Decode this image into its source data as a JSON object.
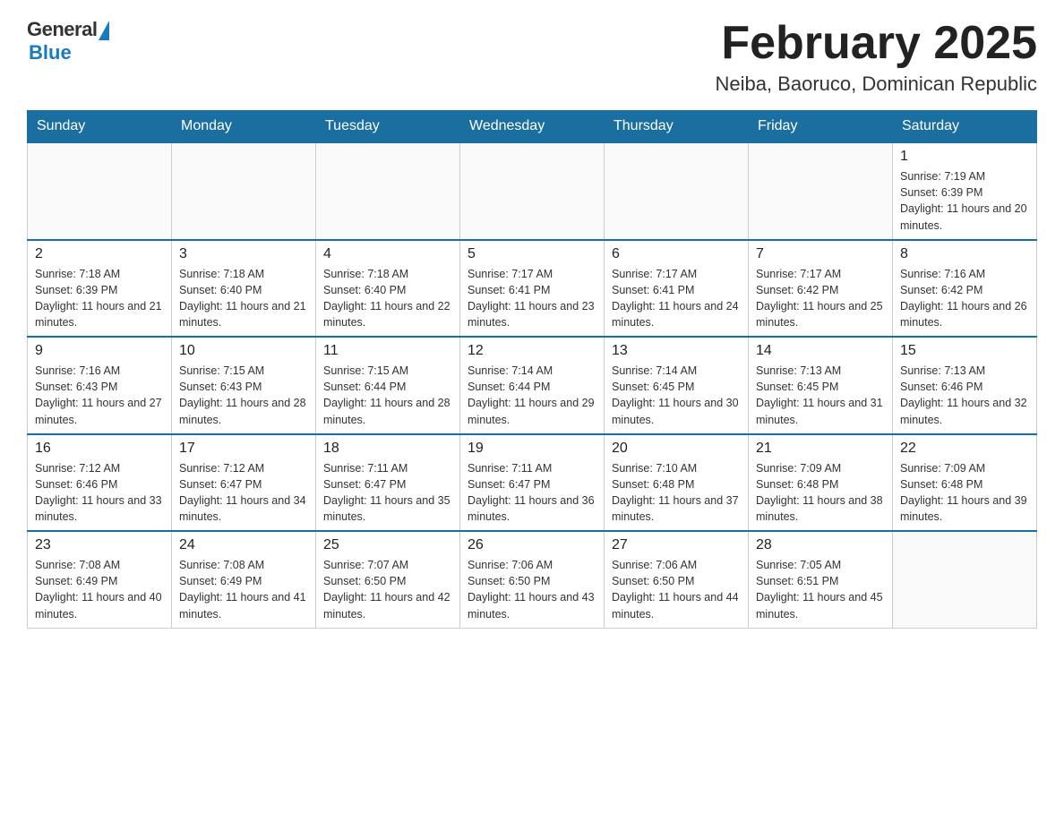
{
  "logo": {
    "general_text": "General",
    "blue_text": "Blue"
  },
  "header": {
    "month_year": "February 2025",
    "location": "Neiba, Baoruco, Dominican Republic"
  },
  "weekdays": [
    "Sunday",
    "Monday",
    "Tuesday",
    "Wednesday",
    "Thursday",
    "Friday",
    "Saturday"
  ],
  "weeks": [
    [
      {
        "day": "",
        "info": ""
      },
      {
        "day": "",
        "info": ""
      },
      {
        "day": "",
        "info": ""
      },
      {
        "day": "",
        "info": ""
      },
      {
        "day": "",
        "info": ""
      },
      {
        "day": "",
        "info": ""
      },
      {
        "day": "1",
        "info": "Sunrise: 7:19 AM\nSunset: 6:39 PM\nDaylight: 11 hours and 20 minutes."
      }
    ],
    [
      {
        "day": "2",
        "info": "Sunrise: 7:18 AM\nSunset: 6:39 PM\nDaylight: 11 hours and 21 minutes."
      },
      {
        "day": "3",
        "info": "Sunrise: 7:18 AM\nSunset: 6:40 PM\nDaylight: 11 hours and 21 minutes."
      },
      {
        "day": "4",
        "info": "Sunrise: 7:18 AM\nSunset: 6:40 PM\nDaylight: 11 hours and 22 minutes."
      },
      {
        "day": "5",
        "info": "Sunrise: 7:17 AM\nSunset: 6:41 PM\nDaylight: 11 hours and 23 minutes."
      },
      {
        "day": "6",
        "info": "Sunrise: 7:17 AM\nSunset: 6:41 PM\nDaylight: 11 hours and 24 minutes."
      },
      {
        "day": "7",
        "info": "Sunrise: 7:17 AM\nSunset: 6:42 PM\nDaylight: 11 hours and 25 minutes."
      },
      {
        "day": "8",
        "info": "Sunrise: 7:16 AM\nSunset: 6:42 PM\nDaylight: 11 hours and 26 minutes."
      }
    ],
    [
      {
        "day": "9",
        "info": "Sunrise: 7:16 AM\nSunset: 6:43 PM\nDaylight: 11 hours and 27 minutes."
      },
      {
        "day": "10",
        "info": "Sunrise: 7:15 AM\nSunset: 6:43 PM\nDaylight: 11 hours and 28 minutes."
      },
      {
        "day": "11",
        "info": "Sunrise: 7:15 AM\nSunset: 6:44 PM\nDaylight: 11 hours and 28 minutes."
      },
      {
        "day": "12",
        "info": "Sunrise: 7:14 AM\nSunset: 6:44 PM\nDaylight: 11 hours and 29 minutes."
      },
      {
        "day": "13",
        "info": "Sunrise: 7:14 AM\nSunset: 6:45 PM\nDaylight: 11 hours and 30 minutes."
      },
      {
        "day": "14",
        "info": "Sunrise: 7:13 AM\nSunset: 6:45 PM\nDaylight: 11 hours and 31 minutes."
      },
      {
        "day": "15",
        "info": "Sunrise: 7:13 AM\nSunset: 6:46 PM\nDaylight: 11 hours and 32 minutes."
      }
    ],
    [
      {
        "day": "16",
        "info": "Sunrise: 7:12 AM\nSunset: 6:46 PM\nDaylight: 11 hours and 33 minutes."
      },
      {
        "day": "17",
        "info": "Sunrise: 7:12 AM\nSunset: 6:47 PM\nDaylight: 11 hours and 34 minutes."
      },
      {
        "day": "18",
        "info": "Sunrise: 7:11 AM\nSunset: 6:47 PM\nDaylight: 11 hours and 35 minutes."
      },
      {
        "day": "19",
        "info": "Sunrise: 7:11 AM\nSunset: 6:47 PM\nDaylight: 11 hours and 36 minutes."
      },
      {
        "day": "20",
        "info": "Sunrise: 7:10 AM\nSunset: 6:48 PM\nDaylight: 11 hours and 37 minutes."
      },
      {
        "day": "21",
        "info": "Sunrise: 7:09 AM\nSunset: 6:48 PM\nDaylight: 11 hours and 38 minutes."
      },
      {
        "day": "22",
        "info": "Sunrise: 7:09 AM\nSunset: 6:48 PM\nDaylight: 11 hours and 39 minutes."
      }
    ],
    [
      {
        "day": "23",
        "info": "Sunrise: 7:08 AM\nSunset: 6:49 PM\nDaylight: 11 hours and 40 minutes."
      },
      {
        "day": "24",
        "info": "Sunrise: 7:08 AM\nSunset: 6:49 PM\nDaylight: 11 hours and 41 minutes."
      },
      {
        "day": "25",
        "info": "Sunrise: 7:07 AM\nSunset: 6:50 PM\nDaylight: 11 hours and 42 minutes."
      },
      {
        "day": "26",
        "info": "Sunrise: 7:06 AM\nSunset: 6:50 PM\nDaylight: 11 hours and 43 minutes."
      },
      {
        "day": "27",
        "info": "Sunrise: 7:06 AM\nSunset: 6:50 PM\nDaylight: 11 hours and 44 minutes."
      },
      {
        "day": "28",
        "info": "Sunrise: 7:05 AM\nSunset: 6:51 PM\nDaylight: 11 hours and 45 minutes."
      },
      {
        "day": "",
        "info": ""
      }
    ]
  ]
}
